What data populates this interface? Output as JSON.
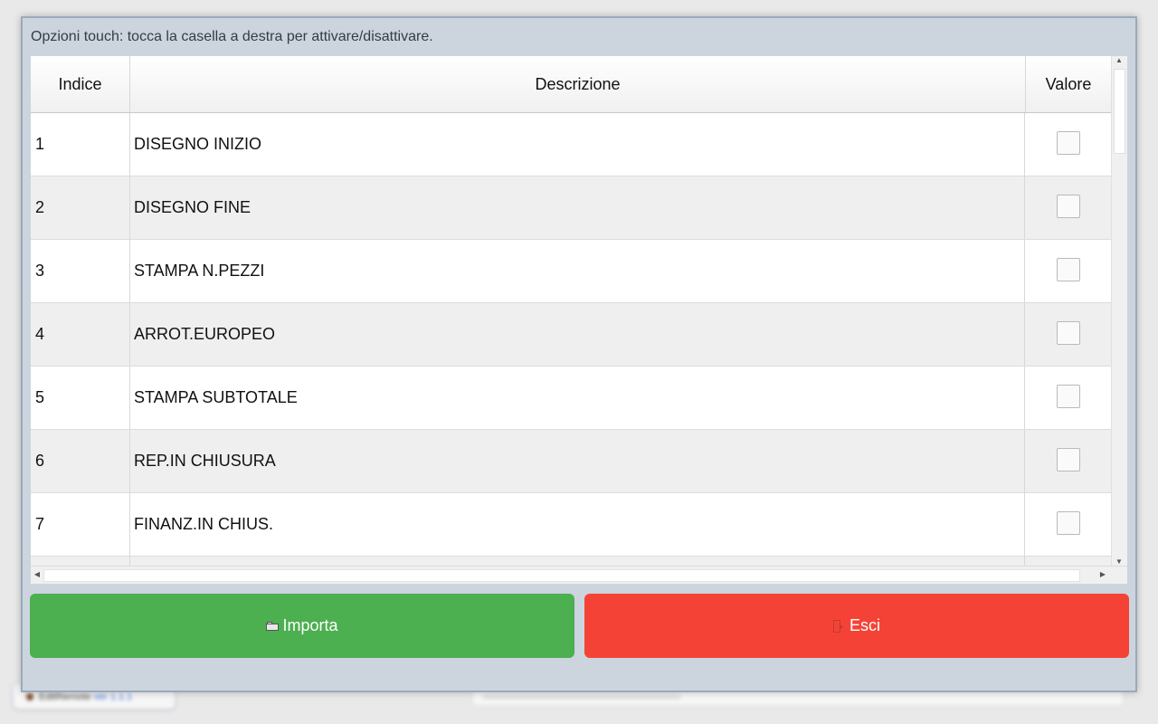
{
  "background": {
    "app_name": "EditRemote",
    "version": "ver 1.1.1"
  },
  "dialog": {
    "title": "Opzioni touch: tocca la casella a destra per attivare/disattivare.",
    "columns": {
      "index": "Indice",
      "description": "Descrizione",
      "value": "Valore"
    },
    "rows": [
      {
        "index": "1",
        "description": "DISEGNO INIZIO",
        "checked": false
      },
      {
        "index": "2",
        "description": "DISEGNO FINE",
        "checked": false
      },
      {
        "index": "3",
        "description": "STAMPA N.PEZZI",
        "checked": false
      },
      {
        "index": "4",
        "description": "ARROT.EUROPEO",
        "checked": false
      },
      {
        "index": "5",
        "description": "STAMPA SUBTOTALE",
        "checked": false
      },
      {
        "index": "6",
        "description": "REP.IN CHIUSURA",
        "checked": false
      },
      {
        "index": "7",
        "description": "FINANZ.IN CHIUS.",
        "checked": false
      }
    ],
    "buttons": {
      "import_label": "Importa",
      "import_icon": "folder-icon",
      "exit_label": "Esci",
      "exit_icon": "exit-icon"
    },
    "colors": {
      "import": "#4caf50",
      "exit": "#f44336"
    }
  }
}
